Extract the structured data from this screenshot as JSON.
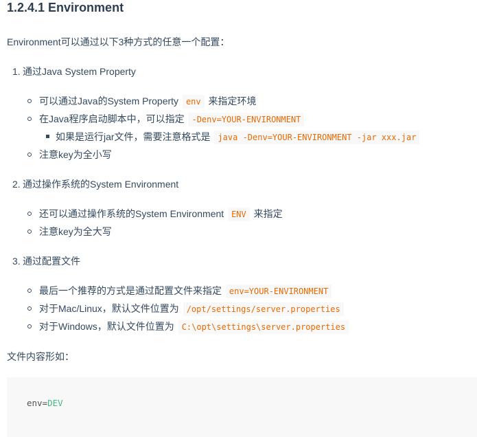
{
  "heading": "1.2.4.1 Environment",
  "intro": "Environment可以通过以下3种方式的任意一个配置：",
  "items": [
    {
      "num": "1.",
      "label": "通过Java System Property",
      "bullets": [
        {
          "before": "可以通过Java的System Property ",
          "code": "env",
          "after": " 来指定环境"
        },
        {
          "before": "在Java程序启动脚本中，可以指定 ",
          "code": "-Denv=YOUR-ENVIRONMENT",
          "after": ""
        },
        {
          "before": "如果是运行jar文件，需要注意格式是 ",
          "code": "java -Denv=YOUR-ENVIRONMENT -jar xxx.jar",
          "after": ""
        },
        {
          "before": "注意key为全小写",
          "code": "",
          "after": ""
        }
      ]
    },
    {
      "num": "2.",
      "label": "通过操作系统的System Environment",
      "bullets": [
        {
          "before": "还可以通过操作系统的System Environment ",
          "code": "ENV",
          "after": " 来指定"
        },
        {
          "before": "注意key为全大写",
          "code": "",
          "after": ""
        }
      ]
    },
    {
      "num": "3.",
      "label": "通过配置文件",
      "bullets": [
        {
          "before": "最后一个推荐的方式是通过配置文件来指定 ",
          "code": "env=YOUR-ENVIRONMENT",
          "after": ""
        },
        {
          "before": "对于Mac/Linux，默认文件位置为 ",
          "code": "/opt/settings/server.properties",
          "after": ""
        },
        {
          "before": "对于Windows，默认文件位置为 ",
          "code": "C:\\opt\\settings\\server.properties",
          "after": ""
        }
      ]
    }
  ],
  "file_content_label": "文件内容形如：",
  "code_block": {
    "key": "env",
    "eq": "=",
    "value": "DEV"
  },
  "colors": {
    "inline_code_text": "#e96900",
    "inline_code_bg": "#f8f8f8",
    "code_value": "#42b983",
    "text": "#34495e"
  }
}
